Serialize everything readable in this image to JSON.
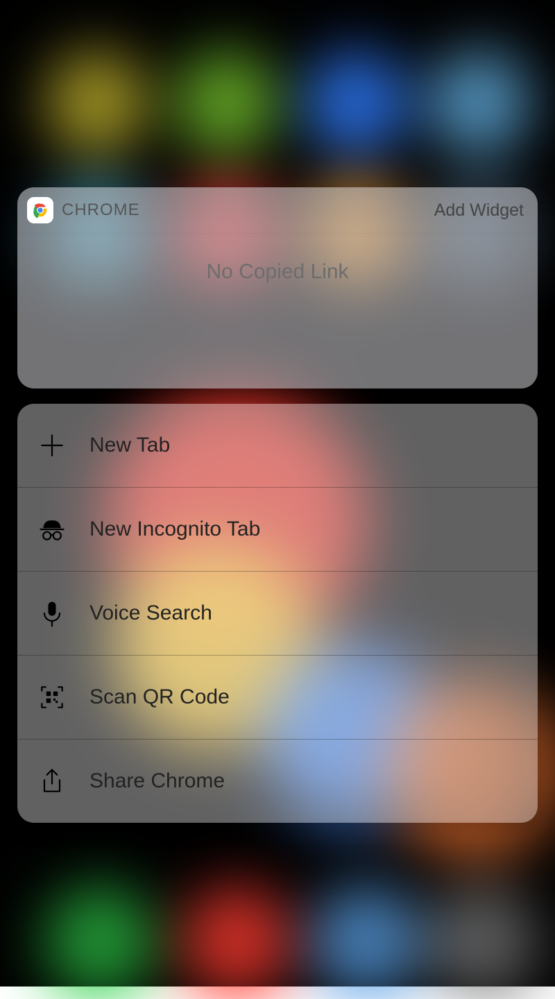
{
  "widget": {
    "app_name": "CHROME",
    "add_widget_label": "Add Widget",
    "body_text": "No Copied Link"
  },
  "menu_items": [
    {
      "icon": "plus-icon",
      "label": "New Tab"
    },
    {
      "icon": "incognito-icon",
      "label": "New Incognito Tab"
    },
    {
      "icon": "mic-icon",
      "label": "Voice Search"
    },
    {
      "icon": "qr-icon",
      "label": "Scan QR Code"
    },
    {
      "icon": "share-icon",
      "label": "Share Chrome"
    }
  ]
}
